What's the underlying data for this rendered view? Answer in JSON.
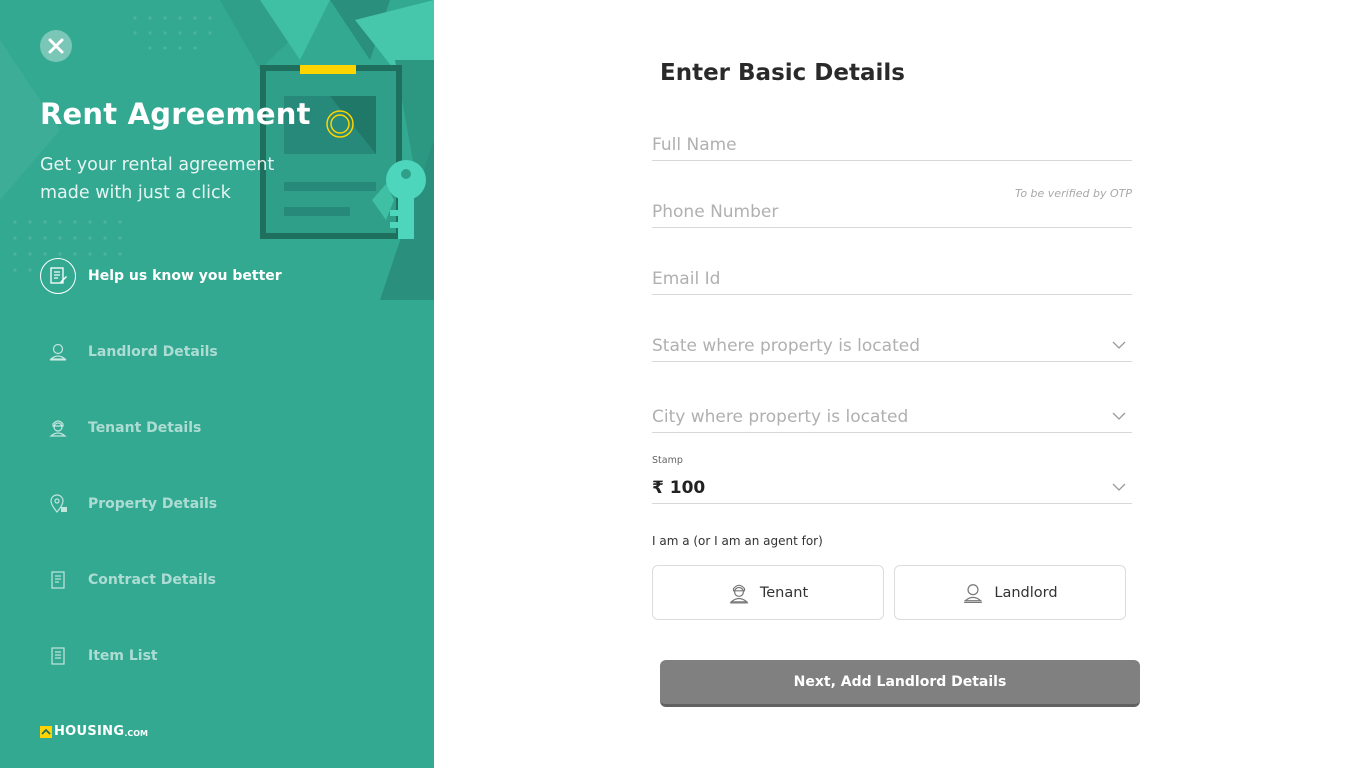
{
  "sidebar": {
    "title": "Rent Agreement",
    "subtitle": "Get your rental agreement made with just a click",
    "steps": [
      {
        "label": "Help us know you better",
        "icon": "form-icon",
        "current": true
      },
      {
        "label": "Landlord Details",
        "icon": "landlord-icon",
        "current": false
      },
      {
        "label": "Tenant Details",
        "icon": "tenant-icon",
        "current": false
      },
      {
        "label": "Property Details",
        "icon": "location-pin-icon",
        "current": false
      },
      {
        "label": "Contract Details",
        "icon": "document-icon",
        "current": false
      },
      {
        "label": "Item List",
        "icon": "list-icon",
        "current": false
      }
    ],
    "brand": {
      "name": "HOUSING",
      "tld": ".COM"
    }
  },
  "form": {
    "title": "Enter Basic Details",
    "full_name": {
      "placeholder": "Full Name",
      "value": ""
    },
    "phone": {
      "placeholder": "Phone Number",
      "value": "",
      "hint": "To be verified by OTP"
    },
    "email": {
      "placeholder": "Email Id",
      "value": ""
    },
    "state": {
      "placeholder": "State where property is located"
    },
    "city": {
      "placeholder": "City where property is located"
    },
    "stamp": {
      "label": "Stamp",
      "value": "₹ 100"
    },
    "role": {
      "label": "I am a (or I am an agent for)",
      "options": [
        {
          "label": "Tenant",
          "icon": "tenant-icon"
        },
        {
          "label": "Landlord",
          "icon": "landlord-icon"
        }
      ]
    },
    "next_button": "Next, Add Landlord Details"
  },
  "colors": {
    "sidebar_bg": "#33a992",
    "accent_yellow": "#ffd400",
    "button_disabled": "#808080"
  }
}
